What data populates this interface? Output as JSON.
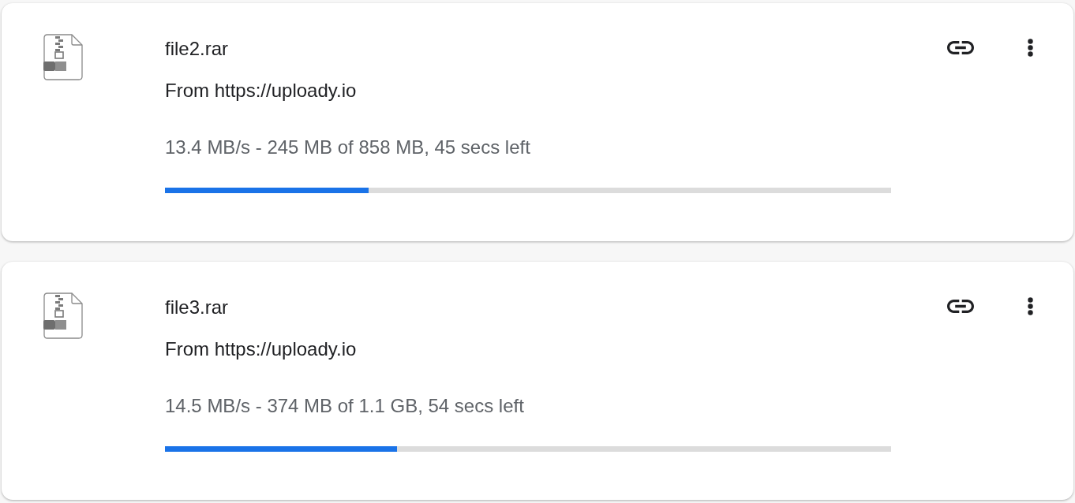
{
  "downloads": [
    {
      "file_name": "file2.rar",
      "source": "From https://uploady.io",
      "status": "13.4 MB/s - 245 MB of 858 MB, 45 secs left",
      "level": 0.28
    },
    {
      "file_name": "file3.rar",
      "source": "From https://uploady.io",
      "status": "14.5 MB/s - 374 MB of 1.1 GB, 54 secs left",
      "level": 0.32
    }
  ]
}
